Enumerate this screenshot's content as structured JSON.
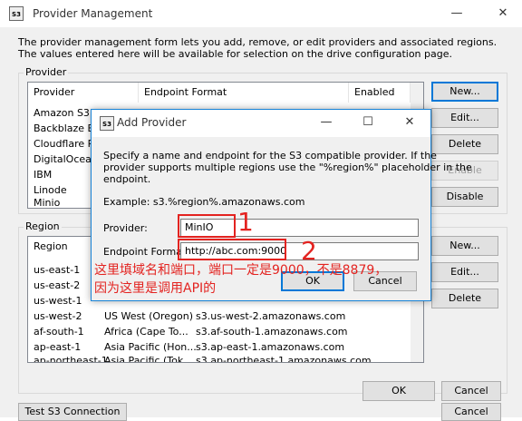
{
  "window": {
    "title": "Provider Management",
    "icon_label": "S3"
  },
  "description_line1": "The provider management form lets you add, remove, or edit providers and associated regions.",
  "description_line2": "The values entered here will be available for selection on the drive configuration page.",
  "provider_group": {
    "label": "Provider",
    "columns": [
      "Provider",
      "Endpoint Format",
      "Enabled"
    ],
    "rows": [
      "Amazon S3",
      "Backblaze B2",
      "Cloudflare R2",
      "DigitalOcean",
      "IBM",
      "Linode",
      "Minio"
    ],
    "buttons": {
      "new": "New...",
      "edit": "Edit...",
      "delete": "Delete",
      "enable": "Enable",
      "disable": "Disable"
    }
  },
  "region_group": {
    "label": "Region",
    "columns": [
      "Region"
    ],
    "rows": [
      {
        "id": "us-east-1",
        "name": "",
        "endpoint": ""
      },
      {
        "id": "us-east-2",
        "name": "",
        "endpoint": ""
      },
      {
        "id": "us-west-1",
        "name": "",
        "endpoint": ""
      },
      {
        "id": "us-west-2",
        "name": "US West (Oregon)",
        "endpoint": "s3.us-west-2.amazonaws.com"
      },
      {
        "id": "af-south-1",
        "name": "Africa (Cape To...",
        "endpoint": "s3.af-south-1.amazonaws.com"
      },
      {
        "id": "ap-east-1",
        "name": "Asia Pacific (Hon...",
        "endpoint": "s3.ap-east-1.amazonaws.com"
      },
      {
        "id": "ap-northeast-1",
        "name": "Asia Pacific (Tok...",
        "endpoint": "s3.ap-northeast-1.amazonaws.com"
      }
    ],
    "buttons": {
      "new": "New...",
      "edit": "Edit...",
      "delete": "Delete"
    }
  },
  "footer": {
    "test": "Test S3 Connection",
    "ok": "OK",
    "cancel": "Cancel",
    "cancel2": "Cancel"
  },
  "dialog": {
    "title": "Add Provider",
    "icon_label": "S3",
    "desc_line1": "Specify a name and endpoint for the S3 compatible provider. If the",
    "desc_line2": "provider supports multiple regions use the \"%region%\" placeholder in the",
    "desc_line3": "endpoint.",
    "example": "Example: s3.%region%.amazonaws.com",
    "provider_label": "Provider:",
    "provider_value": "MinIO",
    "endpoint_label": "Endpoint Format:",
    "endpoint_value": "http://abc.com:9000",
    "ok": "OK",
    "cancel": "Cancel"
  },
  "annotations": {
    "num1": "1",
    "num2": "2",
    "text_line1": "这里填域名和端口，端口一定是9000，不是8879，",
    "text_line2": "因为这里是调用API的"
  },
  "colors": {
    "annotation": "#e32320",
    "focus": "#0078d7"
  }
}
